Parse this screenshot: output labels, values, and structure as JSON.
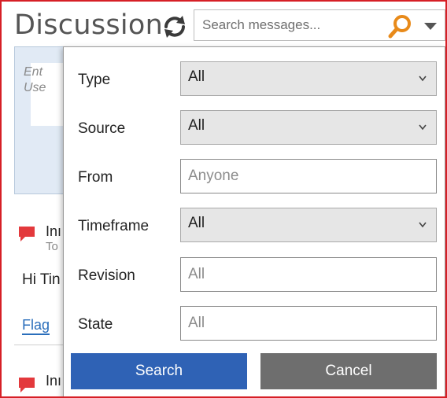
{
  "header": {
    "title": "Discussion",
    "search_placeholder": "Search messages..."
  },
  "background": {
    "compose_placeholder_line1": "Ent",
    "compose_placeholder_line2": "Use",
    "messages": [
      {
        "title": "Inı",
        "subtitle": "To"
      },
      {
        "title": "Inı",
        "subtitle": ""
      }
    ],
    "body_text": "Hi Tin",
    "flag_link": "Flag"
  },
  "filter": {
    "fields": [
      {
        "label": "Type",
        "kind": "select",
        "value": "All"
      },
      {
        "label": "Source",
        "kind": "select",
        "value": "All"
      },
      {
        "label": "From",
        "kind": "text",
        "placeholder": "Anyone"
      },
      {
        "label": "Timeframe",
        "kind": "select",
        "value": "All"
      },
      {
        "label": "Revision",
        "kind": "text",
        "placeholder": "All"
      },
      {
        "label": "State",
        "kind": "text",
        "placeholder": "All"
      }
    ],
    "search_button": "Search",
    "cancel_button": "Cancel"
  },
  "colors": {
    "frame_border": "#d61f26",
    "search_icon": "#e88a1a",
    "search_button": "#2f62b5",
    "cancel_button": "#6e6e6e",
    "message_icon": "#e3393c",
    "link": "#2a6ebb"
  },
  "icons": {
    "refresh": "refresh-icon",
    "search": "search-icon",
    "dropdown": "chevron-down-icon",
    "message": "message-bubble-icon"
  }
}
